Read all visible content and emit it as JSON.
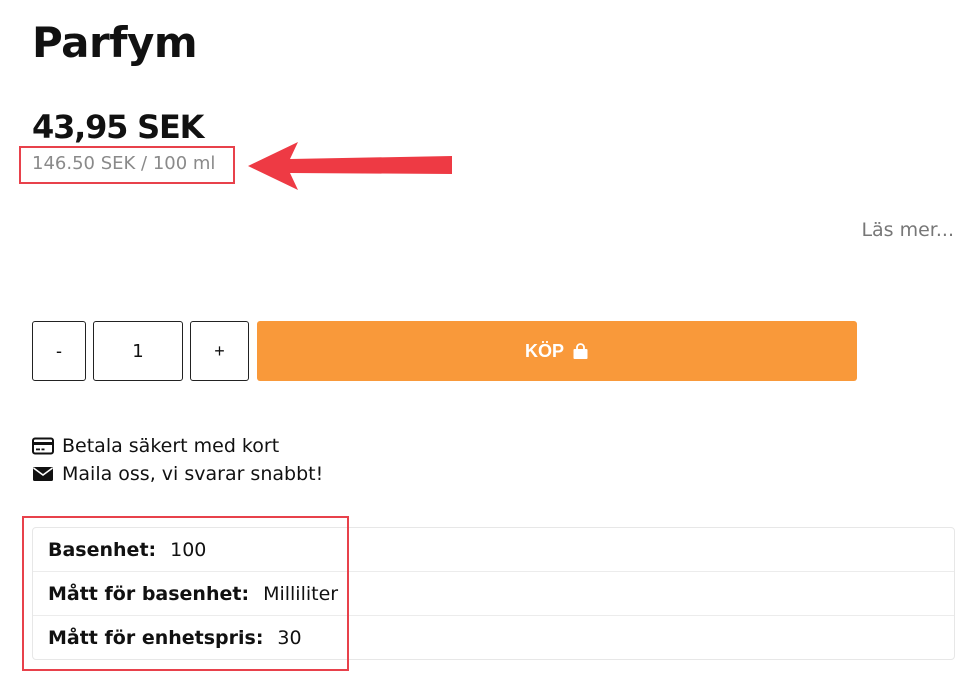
{
  "product": {
    "title": "Parfym",
    "price": "43,95 SEK",
    "unit_price": "146.50 SEK / 100 ml",
    "read_more": "Läs mer..."
  },
  "purchase": {
    "minus_label": "-",
    "quantity": "1",
    "plus_label": "+",
    "buy_label": "KÖP"
  },
  "info": {
    "pay_text": "Betala säkert med kort",
    "mail_text": "Maila oss, vi svarar snabbt!"
  },
  "specs": [
    {
      "label": "Basenhet:",
      "value": "100"
    },
    {
      "label": "Mått för basenhet:",
      "value": "Milliliter"
    },
    {
      "label": "Mått för enhetspris:",
      "value": "30"
    }
  ],
  "colors": {
    "accent": "#f9993a",
    "highlight": "#e8414b",
    "muted": "#8a8a8a"
  },
  "icons": [
    "shopping-bag-icon",
    "credit-card-icon",
    "envelope-icon",
    "arrow-left-icon"
  ]
}
